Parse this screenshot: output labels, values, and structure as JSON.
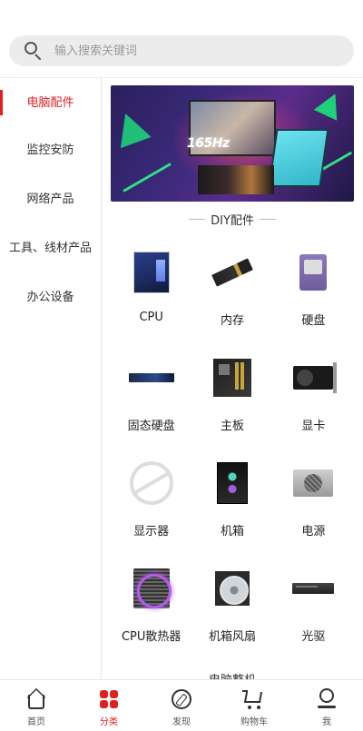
{
  "search": {
    "placeholder": "输入搜索关键词"
  },
  "sidebar": {
    "items": [
      {
        "label": "电脑配件",
        "active": true
      },
      {
        "label": "监控安防",
        "active": false
      },
      {
        "label": "网络产品",
        "active": false
      },
      {
        "label": "工具、线材产品",
        "active": false
      },
      {
        "label": "办公设备",
        "active": false
      }
    ]
  },
  "banner": {
    "text": "165Hz"
  },
  "section": {
    "title": "DIY配件",
    "next_title": "电脑整机"
  },
  "products": [
    {
      "label": "CPU",
      "icon": "cpu-icon"
    },
    {
      "label": "内存",
      "icon": "ram-icon"
    },
    {
      "label": "硬盘",
      "icon": "hdd-icon"
    },
    {
      "label": "固态硬盘",
      "icon": "ssd-icon"
    },
    {
      "label": "主板",
      "icon": "motherboard-icon"
    },
    {
      "label": "显卡",
      "icon": "gpu-icon"
    },
    {
      "label": "显示器",
      "icon": "monitor-placeholder-icon"
    },
    {
      "label": "机箱",
      "icon": "case-icon"
    },
    {
      "label": "电源",
      "icon": "psu-icon"
    },
    {
      "label": "CPU散热器",
      "icon": "cpu-cooler-icon"
    },
    {
      "label": "机箱风扇",
      "icon": "case-fan-icon"
    },
    {
      "label": "光驱",
      "icon": "optical-drive-icon"
    }
  ],
  "bottom_nav": [
    {
      "label": "首页",
      "icon": "home-icon",
      "active": false
    },
    {
      "label": "分类",
      "icon": "category-icon",
      "active": true
    },
    {
      "label": "发现",
      "icon": "discover-icon",
      "active": false
    },
    {
      "label": "购物车",
      "icon": "cart-icon",
      "active": false
    },
    {
      "label": "我",
      "icon": "profile-icon",
      "active": false
    }
  ],
  "colors": {
    "accent": "#e02020",
    "search_bg": "#ececec"
  }
}
